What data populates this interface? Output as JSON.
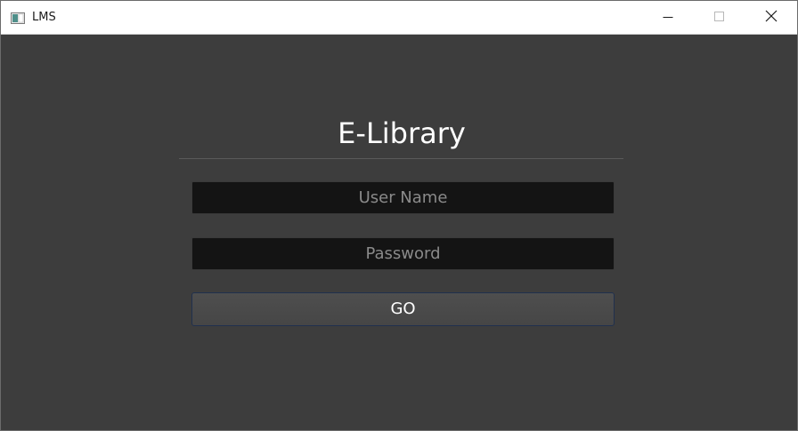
{
  "window": {
    "title": "LMS",
    "icon": "app-window-icon",
    "controls": {
      "minimize": "minimize-icon",
      "maximize": "maximize-icon",
      "close": "close-icon"
    }
  },
  "login": {
    "heading": "E-Library",
    "username_placeholder": "User Name",
    "username_value": "",
    "password_placeholder": "Password",
    "password_value": "",
    "submit_label": "GO"
  },
  "colors": {
    "background": "#3d3d3d",
    "field_background": "#141414",
    "button_border": "#20304e",
    "heading_text": "#ffffff"
  }
}
